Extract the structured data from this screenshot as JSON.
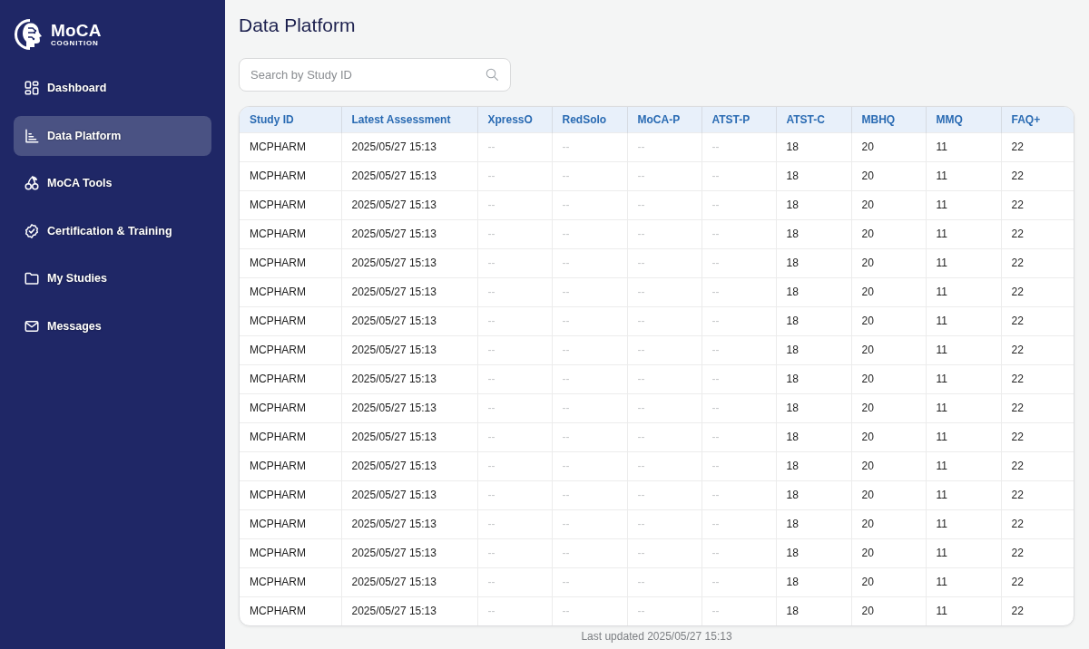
{
  "sidebar": {
    "logo": {
      "wordmark": "MoCA",
      "tagline": "COGNITION"
    },
    "items": [
      {
        "label": "Dashboard",
        "selected": false
      },
      {
        "label": "Data Platform",
        "selected": true
      },
      {
        "label": "MoCA Tools",
        "selected": false
      },
      {
        "label": "Certification & Training",
        "selected": false
      },
      {
        "label": "My Studies",
        "selected": false
      },
      {
        "label": "Messages",
        "selected": false
      }
    ]
  },
  "page": {
    "title": "Data Platform"
  },
  "search": {
    "placeholder": "Search by Study ID"
  },
  "table": {
    "columns": [
      "Study ID",
      "Latest Assessment",
      "XpressO",
      "RedSolo",
      "MoCA-P",
      "ATST-P",
      "ATST-C",
      "MBHQ",
      "MMQ",
      "FAQ+"
    ],
    "rows": [
      {
        "cells": [
          {
            "text": "MCPHARM",
            "muted": false
          },
          {
            "text": "2025/05/27 15:13",
            "muted": false
          },
          {
            "text": "--",
            "muted": true
          },
          {
            "text": "--",
            "muted": true
          },
          {
            "text": "--",
            "muted": true
          },
          {
            "text": "--",
            "muted": true
          },
          {
            "text": "18",
            "muted": false
          },
          {
            "text": "20",
            "muted": false
          },
          {
            "text": "11",
            "muted": false
          },
          {
            "text": "22",
            "muted": false
          }
        ]
      },
      {
        "cells": [
          {
            "text": "MCPHARM",
            "muted": false
          },
          {
            "text": "2025/05/27 15:13",
            "muted": false
          },
          {
            "text": "--",
            "muted": true
          },
          {
            "text": "--",
            "muted": true
          },
          {
            "text": "--",
            "muted": true
          },
          {
            "text": "--",
            "muted": true
          },
          {
            "text": "18",
            "muted": false
          },
          {
            "text": "20",
            "muted": false
          },
          {
            "text": "11",
            "muted": false
          },
          {
            "text": "22",
            "muted": false
          }
        ]
      },
      {
        "cells": [
          {
            "text": "MCPHARM",
            "muted": false
          },
          {
            "text": "2025/05/27 15:13",
            "muted": false
          },
          {
            "text": "--",
            "muted": true
          },
          {
            "text": "--",
            "muted": true
          },
          {
            "text": "--",
            "muted": true
          },
          {
            "text": "--",
            "muted": true
          },
          {
            "text": "18",
            "muted": false
          },
          {
            "text": "20",
            "muted": false
          },
          {
            "text": "11",
            "muted": false
          },
          {
            "text": "22",
            "muted": false
          }
        ]
      },
      {
        "cells": [
          {
            "text": "MCPHARM",
            "muted": false
          },
          {
            "text": "2025/05/27 15:13",
            "muted": false
          },
          {
            "text": "--",
            "muted": true
          },
          {
            "text": "--",
            "muted": true
          },
          {
            "text": "--",
            "muted": true
          },
          {
            "text": "--",
            "muted": true
          },
          {
            "text": "18",
            "muted": false
          },
          {
            "text": "20",
            "muted": false
          },
          {
            "text": "11",
            "muted": false
          },
          {
            "text": "22",
            "muted": false
          }
        ]
      },
      {
        "cells": [
          {
            "text": "MCPHARM",
            "muted": false
          },
          {
            "text": "2025/05/27 15:13",
            "muted": false
          },
          {
            "text": "--",
            "muted": true
          },
          {
            "text": "--",
            "muted": true
          },
          {
            "text": "--",
            "muted": true
          },
          {
            "text": "--",
            "muted": true
          },
          {
            "text": "18",
            "muted": false
          },
          {
            "text": "20",
            "muted": false
          },
          {
            "text": "11",
            "muted": false
          },
          {
            "text": "22",
            "muted": false
          }
        ]
      },
      {
        "cells": [
          {
            "text": "MCPHARM",
            "muted": false
          },
          {
            "text": "2025/05/27 15:13",
            "muted": false
          },
          {
            "text": "--",
            "muted": true
          },
          {
            "text": "--",
            "muted": true
          },
          {
            "text": "--",
            "muted": true
          },
          {
            "text": "--",
            "muted": true
          },
          {
            "text": "18",
            "muted": false
          },
          {
            "text": "20",
            "muted": false
          },
          {
            "text": "11",
            "muted": false
          },
          {
            "text": "22",
            "muted": false
          }
        ]
      },
      {
        "cells": [
          {
            "text": "MCPHARM",
            "muted": false
          },
          {
            "text": "2025/05/27 15:13",
            "muted": false
          },
          {
            "text": "--",
            "muted": true
          },
          {
            "text": "--",
            "muted": true
          },
          {
            "text": "--",
            "muted": true
          },
          {
            "text": "--",
            "muted": true
          },
          {
            "text": "18",
            "muted": false
          },
          {
            "text": "20",
            "muted": false
          },
          {
            "text": "11",
            "muted": false
          },
          {
            "text": "22",
            "muted": false
          }
        ]
      },
      {
        "cells": [
          {
            "text": "MCPHARM",
            "muted": false
          },
          {
            "text": "2025/05/27 15:13",
            "muted": false
          },
          {
            "text": "--",
            "muted": true
          },
          {
            "text": "--",
            "muted": true
          },
          {
            "text": "--",
            "muted": true
          },
          {
            "text": "--",
            "muted": true
          },
          {
            "text": "18",
            "muted": false
          },
          {
            "text": "20",
            "muted": false
          },
          {
            "text": "11",
            "muted": false
          },
          {
            "text": "22",
            "muted": false
          }
        ]
      },
      {
        "cells": [
          {
            "text": "MCPHARM",
            "muted": false
          },
          {
            "text": "2025/05/27 15:13",
            "muted": false
          },
          {
            "text": "--",
            "muted": true
          },
          {
            "text": "--",
            "muted": true
          },
          {
            "text": "--",
            "muted": true
          },
          {
            "text": "--",
            "muted": true
          },
          {
            "text": "18",
            "muted": false
          },
          {
            "text": "20",
            "muted": false
          },
          {
            "text": "11",
            "muted": false
          },
          {
            "text": "22",
            "muted": false
          }
        ]
      },
      {
        "cells": [
          {
            "text": "MCPHARM",
            "muted": false
          },
          {
            "text": "2025/05/27 15:13",
            "muted": false
          },
          {
            "text": "--",
            "muted": true
          },
          {
            "text": "--",
            "muted": true
          },
          {
            "text": "--",
            "muted": true
          },
          {
            "text": "--",
            "muted": true
          },
          {
            "text": "18",
            "muted": false
          },
          {
            "text": "20",
            "muted": false
          },
          {
            "text": "11",
            "muted": false
          },
          {
            "text": "22",
            "muted": false
          }
        ]
      },
      {
        "cells": [
          {
            "text": "MCPHARM",
            "muted": false
          },
          {
            "text": "2025/05/27 15:13",
            "muted": false
          },
          {
            "text": "--",
            "muted": true
          },
          {
            "text": "--",
            "muted": true
          },
          {
            "text": "--",
            "muted": true
          },
          {
            "text": "--",
            "muted": true
          },
          {
            "text": "18",
            "muted": false
          },
          {
            "text": "20",
            "muted": false
          },
          {
            "text": "11",
            "muted": false
          },
          {
            "text": "22",
            "muted": false
          }
        ]
      },
      {
        "cells": [
          {
            "text": "MCPHARM",
            "muted": false
          },
          {
            "text": "2025/05/27 15:13",
            "muted": false
          },
          {
            "text": "--",
            "muted": true
          },
          {
            "text": "--",
            "muted": true
          },
          {
            "text": "--",
            "muted": true
          },
          {
            "text": "--",
            "muted": true
          },
          {
            "text": "18",
            "muted": false
          },
          {
            "text": "20",
            "muted": false
          },
          {
            "text": "11",
            "muted": false
          },
          {
            "text": "22",
            "muted": false
          }
        ]
      },
      {
        "cells": [
          {
            "text": "MCPHARM",
            "muted": false
          },
          {
            "text": "2025/05/27 15:13",
            "muted": false
          },
          {
            "text": "--",
            "muted": true
          },
          {
            "text": "--",
            "muted": true
          },
          {
            "text": "--",
            "muted": true
          },
          {
            "text": "--",
            "muted": true
          },
          {
            "text": "18",
            "muted": false
          },
          {
            "text": "20",
            "muted": false
          },
          {
            "text": "11",
            "muted": false
          },
          {
            "text": "22",
            "muted": false
          }
        ]
      },
      {
        "cells": [
          {
            "text": "MCPHARM",
            "muted": false
          },
          {
            "text": "2025/05/27 15:13",
            "muted": false
          },
          {
            "text": "--",
            "muted": true
          },
          {
            "text": "--",
            "muted": true
          },
          {
            "text": "--",
            "muted": true
          },
          {
            "text": "--",
            "muted": true
          },
          {
            "text": "18",
            "muted": false
          },
          {
            "text": "20",
            "muted": false
          },
          {
            "text": "11",
            "muted": false
          },
          {
            "text": "22",
            "muted": false
          }
        ]
      },
      {
        "cells": [
          {
            "text": "MCPHARM",
            "muted": false
          },
          {
            "text": "2025/05/27 15:13",
            "muted": false
          },
          {
            "text": "--",
            "muted": true
          },
          {
            "text": "--",
            "muted": true
          },
          {
            "text": "--",
            "muted": true
          },
          {
            "text": "--",
            "muted": true
          },
          {
            "text": "18",
            "muted": false
          },
          {
            "text": "20",
            "muted": false
          },
          {
            "text": "11",
            "muted": false
          },
          {
            "text": "22",
            "muted": false
          }
        ]
      },
      {
        "cells": [
          {
            "text": "MCPHARM",
            "muted": false
          },
          {
            "text": "2025/05/27 15:13",
            "muted": false
          },
          {
            "text": "--",
            "muted": true
          },
          {
            "text": "--",
            "muted": true
          },
          {
            "text": "--",
            "muted": true
          },
          {
            "text": "--",
            "muted": true
          },
          {
            "text": "18",
            "muted": false
          },
          {
            "text": "20",
            "muted": false
          },
          {
            "text": "11",
            "muted": false
          },
          {
            "text": "22",
            "muted": false
          }
        ]
      },
      {
        "cells": [
          {
            "text": "MCPHARM",
            "muted": false
          },
          {
            "text": "2025/05/27 15:13",
            "muted": false
          },
          {
            "text": "--",
            "muted": true
          },
          {
            "text": "--",
            "muted": true
          },
          {
            "text": "--",
            "muted": true
          },
          {
            "text": "--",
            "muted": true
          },
          {
            "text": "18",
            "muted": false
          },
          {
            "text": "20",
            "muted": false
          },
          {
            "text": "11",
            "muted": false
          },
          {
            "text": "22",
            "muted": false
          }
        ]
      }
    ]
  },
  "footer": {
    "updated": "Last updated 2025/05/27 15:13"
  }
}
